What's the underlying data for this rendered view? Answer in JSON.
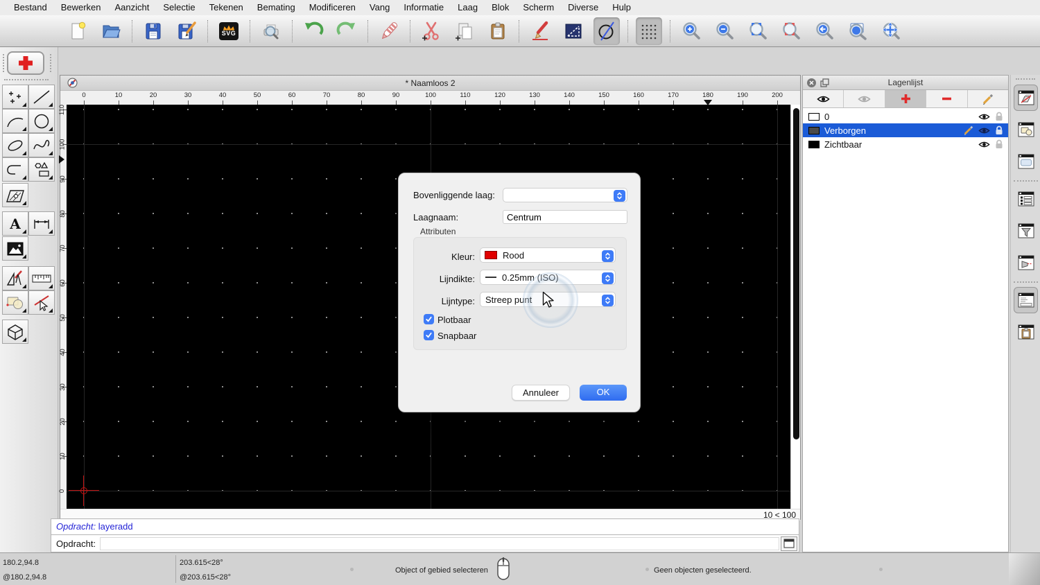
{
  "menu_bar": {
    "items": [
      "Bestand",
      "Bewerken",
      "Aanzicht",
      "Selectie",
      "Tekenen",
      "Bemating",
      "Modificeren",
      "Vang",
      "Informatie",
      "Laag",
      "Blok",
      "Scherm",
      "Diverse",
      "Hulp"
    ]
  },
  "toolbar": {
    "svg_label": "SVG",
    "icons": [
      "new-file",
      "open-file",
      "save",
      "save-as",
      "svg-export",
      "print-preview",
      "undo",
      "redo",
      "delete",
      "cut",
      "copy",
      "paste",
      "draw-pencil",
      "selection-rectangle",
      "ellipse-tool-active",
      "grid-toggle-active",
      "zoom-in",
      "zoom-out",
      "auto-zoom",
      "zoom-selection",
      "previous-view",
      "zoom-window",
      "pan"
    ]
  },
  "tool_palette": {
    "current_action": "add-layer",
    "tools": [
      "point",
      "line",
      "arc",
      "circle",
      "ellipse",
      "spline",
      "polyline",
      "shape",
      "hatch",
      "text",
      "dimension",
      "image",
      "drafting-tools",
      "measure",
      "modify",
      "pick",
      "solid"
    ]
  },
  "drawing_window": {
    "title": "* Naamloos 2",
    "h_ruler": [
      "0",
      "10",
      "20",
      "30",
      "40",
      "50",
      "60",
      "70",
      "80",
      "90",
      "100",
      "110",
      "120",
      "130",
      "140",
      "150",
      "160",
      "170",
      "180",
      "190",
      "200"
    ],
    "v_ruler": [
      "110",
      "100",
      "90",
      "80",
      "70",
      "60",
      "50",
      "40",
      "30",
      "20",
      "10",
      "0"
    ],
    "grid_status": "10 < 100"
  },
  "command": {
    "history_label": "Opdracht:",
    "history_command": "layeradd",
    "prompt_label": "Opdracht:",
    "input_value": ""
  },
  "status_bar": {
    "coord_abs": "180.2,94.8",
    "coord_rel": "@180.2,94.8",
    "polar_abs": "203.615<28°",
    "polar_rel": "@203.615<28°",
    "hint": "Object of gebied selecteren",
    "selection_info": "Geen objecten geselecteerd."
  },
  "layer_list": {
    "title": "Lagenlijst",
    "layers": [
      {
        "name": "0",
        "color": "#ffffff",
        "selected": false
      },
      {
        "name": "Verborgen",
        "color": "#4a4a4a",
        "selected": true
      },
      {
        "name": "Zichtbaar",
        "color": "#000000",
        "selected": false
      }
    ],
    "selection_color": "#1b5bd7"
  },
  "dialog": {
    "parent_layer_label": "Bovenliggende laag:",
    "parent_layer_value": "",
    "layer_name_label": "Laagnaam:",
    "layer_name_value": "Centrum",
    "attributes_label": "Attributen",
    "color_label": "Kleur:",
    "color_value": "Rood",
    "color_hex": "#e00000",
    "lineweight_label": "Lijndikte:",
    "lineweight_value": "0.25mm (ISO)",
    "linetype_label": "Lijntype:",
    "linetype_value": "Streep punt",
    "plottable_label": "Plotbaar",
    "plottable_checked": true,
    "snappable_label": "Snapbaar",
    "snappable_checked": true,
    "cancel_label": "Annuleer",
    "ok_label": "OK",
    "accent_color": "#3e7bf7"
  }
}
